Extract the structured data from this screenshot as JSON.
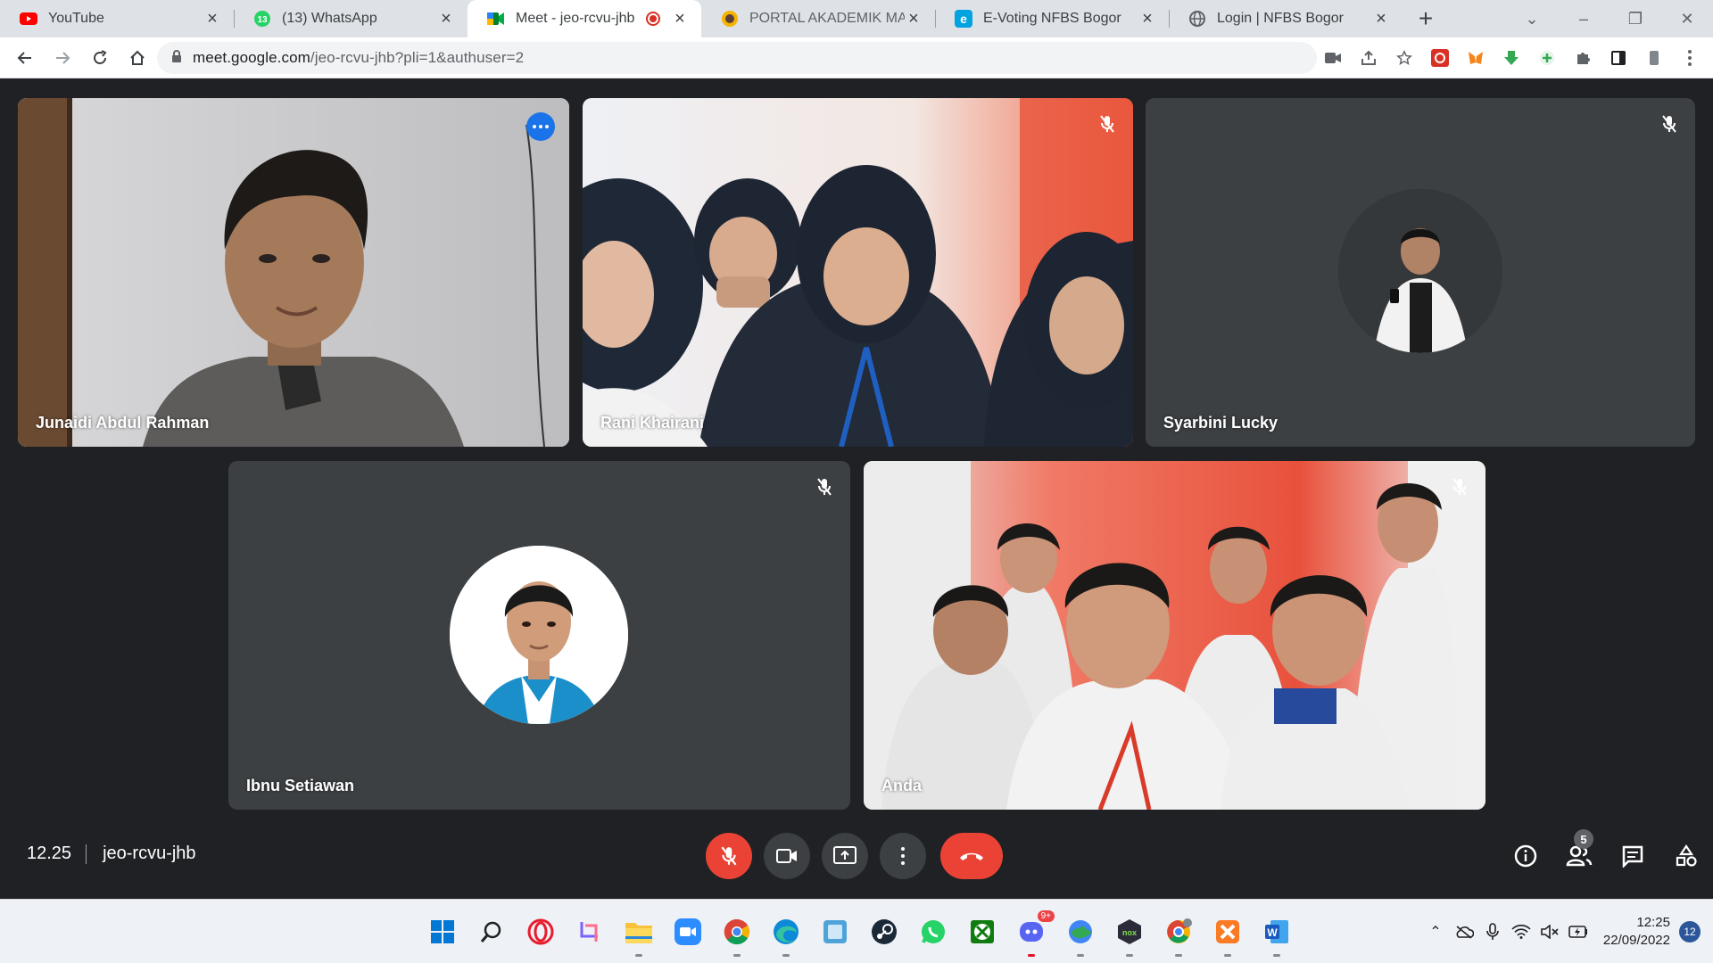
{
  "browser": {
    "tabs": [
      {
        "title": "YouTube",
        "icon": "youtube-icon"
      },
      {
        "title": "(13) WhatsApp",
        "icon": "whatsapp-icon",
        "badge": "13"
      },
      {
        "title": "Meet - jeo-rcvu-jhb",
        "icon": "google-meet-icon",
        "active": true,
        "recording": true
      },
      {
        "title": "PORTAL AKADEMIK MAHASISWA",
        "icon": "portal-icon"
      },
      {
        "title": "E-Voting NFBS Bogor",
        "icon": "evoting-icon"
      },
      {
        "title": "Login | NFBS Bogor",
        "icon": "globe-icon"
      }
    ],
    "url_host": "meet.google.com",
    "url_path": "/jeo-rcvu-jhb?pli=1&authuser=2"
  },
  "meet": {
    "participants": [
      {
        "name": "Junaidi Abdul Rahman",
        "video": true,
        "muted": false,
        "speaking": true
      },
      {
        "name": "Rani Khairani",
        "video": true,
        "muted": true
      },
      {
        "name": "Syarbini Lucky",
        "video": false,
        "muted": true
      },
      {
        "name": "Ibnu Setiawan",
        "video": false,
        "muted": true
      },
      {
        "name": "Anda",
        "video": true,
        "muted": true
      }
    ],
    "time": "12.25",
    "code": "jeo-rcvu-jhb",
    "people_count": "5"
  },
  "taskbar": {
    "apps": [
      "windows-start-icon",
      "search-icon",
      "opera-icon",
      "snipping-tool-icon",
      "file-explorer-icon",
      "zoom-icon",
      "chrome-icon",
      "edge-icon",
      "photos-icon",
      "steam-icon",
      "whatsapp-icon",
      "xbox-icon",
      "discord-icon",
      "google-earth-icon",
      "nox-icon",
      "chrome-profile-icon",
      "xampp-icon",
      "word-icon"
    ],
    "discord_badge": "9+",
    "time": "12:25",
    "date": "22/09/2022",
    "notifications": "12"
  },
  "colors": {
    "meet_bg": "#202124",
    "tile_bg": "#3c4043",
    "accent_red": "#ea4335",
    "speaker_outline": "#8ab4f8"
  }
}
